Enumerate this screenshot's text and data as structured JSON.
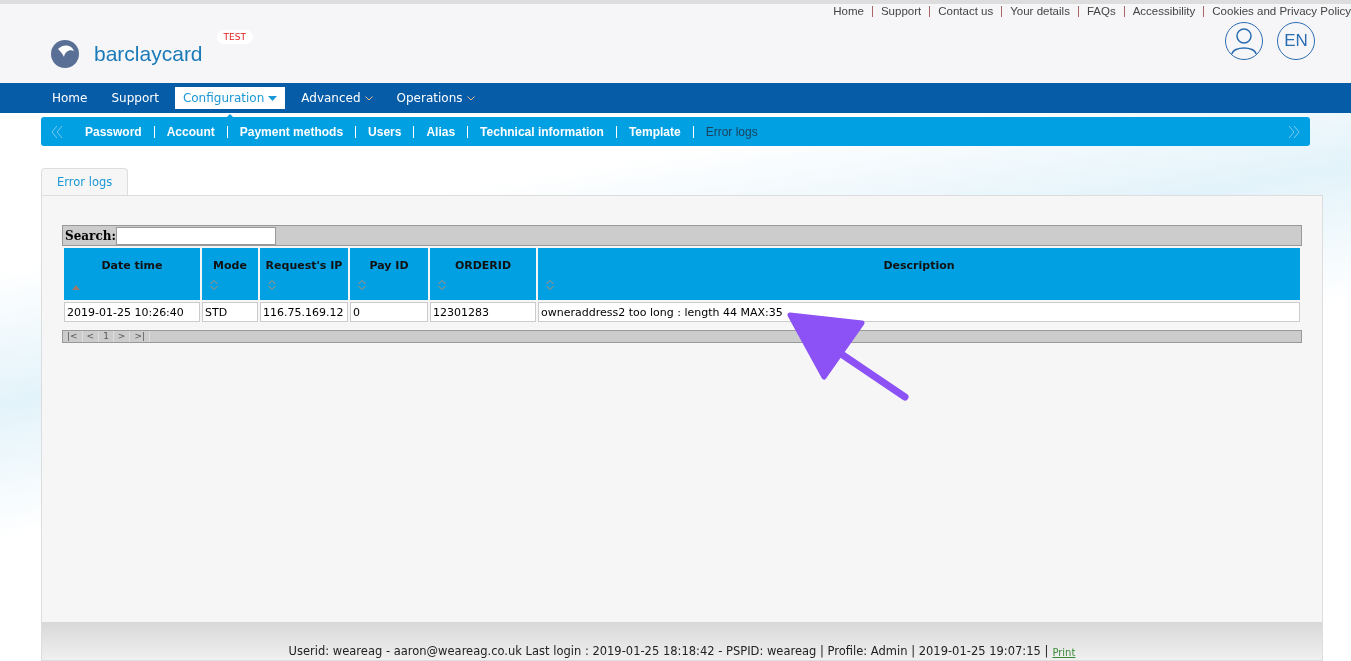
{
  "top_links": [
    "Home",
    "Support",
    "Contact us",
    "Your details",
    "FAQs",
    "Accessibility",
    "Cookies and Privacy Policy"
  ],
  "logo": {
    "text": "barclaycard",
    "badge": "TEST"
  },
  "language": "EN",
  "main_nav": [
    {
      "label": "Home",
      "selected": false,
      "dropdown": false
    },
    {
      "label": "Support",
      "selected": false,
      "dropdown": false
    },
    {
      "label": "Configuration",
      "selected": true,
      "dropdown": true
    },
    {
      "label": "Advanced",
      "selected": false,
      "dropdown": true
    },
    {
      "label": "Operations",
      "selected": false,
      "dropdown": true
    }
  ],
  "sub_nav": [
    {
      "label": "Password",
      "selected": false
    },
    {
      "label": "Account",
      "selected": false
    },
    {
      "label": "Payment methods",
      "selected": false
    },
    {
      "label": "Users",
      "selected": false
    },
    {
      "label": "Alias",
      "selected": false
    },
    {
      "label": "Technical information",
      "selected": false
    },
    {
      "label": "Template",
      "selected": false
    },
    {
      "label": "Error logs",
      "selected": true
    }
  ],
  "tabs": [
    {
      "label": "Error logs",
      "selected": true
    }
  ],
  "search": {
    "label": "Search:"
  },
  "table": {
    "columns": [
      {
        "label": "Date time",
        "sorted": true
      },
      {
        "label": "Mode",
        "sorted": false
      },
      {
        "label": "Request's IP",
        "sorted": false
      },
      {
        "label": "Pay ID",
        "sorted": false
      },
      {
        "label": "ORDERID",
        "sorted": false
      },
      {
        "label": "Description",
        "sorted": false
      }
    ],
    "rows": [
      [
        "2019-01-25 10:26:40",
        "STD",
        "116.75.169.12",
        "0",
        "12301283",
        "owneraddress2 too long : length 44 MAX:35"
      ]
    ]
  },
  "pager": [
    "|<",
    "<",
    "1",
    ">",
    ">|"
  ],
  "footer": {
    "text": "Userid: weareag - aaron@weareag.co.uk Last login : 2019-01-25 18:18:42 - PSPID: weareag | Profile: Admin | 2019-01-25 19:07:15 |",
    "link": "Print"
  }
}
